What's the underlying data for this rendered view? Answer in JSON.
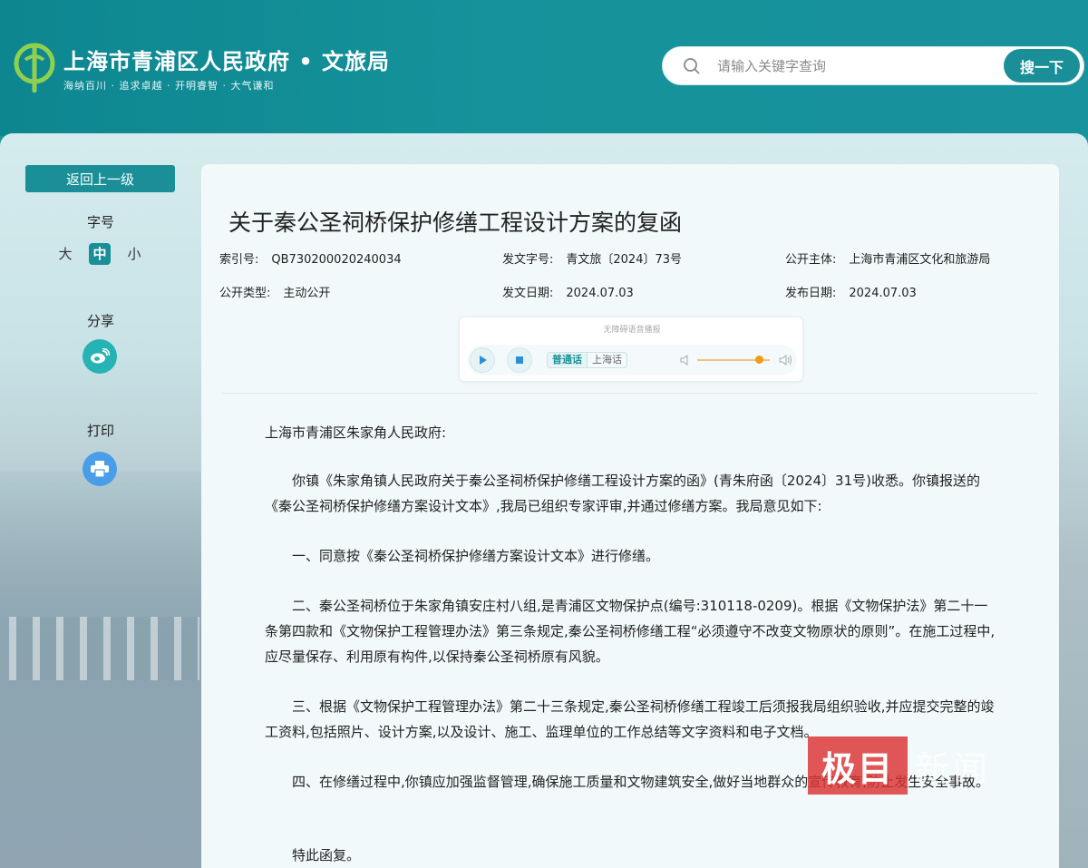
{
  "header": {
    "site_title": "上海市青浦区人民政府 • 文旅局",
    "slogan": "海纳百川 · 追求卓越 · 开明睿智 · 大气谦和",
    "search_placeholder": "请输入关键字查询",
    "search_button": "搜一下"
  },
  "sidebar": {
    "back_button": "返回上一级",
    "font_size_label": "字号",
    "font_sizes": [
      "大",
      "中",
      "小"
    ],
    "share_label": "分享",
    "print_label": "打印"
  },
  "document": {
    "title": "关于秦公圣祠桥保护修缮工程设计方案的复函",
    "meta": {
      "index_key": "索引号:",
      "index_val": "QB730200020240034",
      "docno_key": "发文字号:",
      "docno_val": "青文旅〔2024〕73号",
      "subject_key": "公开主体:",
      "subject_val": "上海市青浦区文化和旅游局",
      "type_key": "公开类型:",
      "type_val": "主动公开",
      "issue_key": "发文日期:",
      "issue_val": "2024.07.03",
      "publish_key": "发布日期:",
      "publish_val": "2024.07.03"
    },
    "player": {
      "title": "无障碍语音播报",
      "lang_mandarin": "普通话",
      "lang_shanghai": "上海话"
    },
    "salutation": "上海市青浦区朱家角人民政府:",
    "paragraphs": [
      "你镇《朱家角镇人民政府关于秦公圣祠桥保护修缮工程设计方案的函》(青朱府函〔2024〕31号)收悉。你镇报送的《秦公圣祠桥保护修缮方案设计文本》,我局已组织专家评审,并通过修缮方案。我局意见如下:",
      "一、同意按《秦公圣祠桥保护修缮方案设计文本》进行修缮。",
      "二、秦公圣祠桥位于朱家角镇安庄村八组,是青浦区文物保护点(编号:310118-0209)。根据《文物保护法》第二十一条第四款和《文物保护工程管理办法》第三条规定,秦公圣祠桥修缮工程“必须遵守不改变文物原状的原则”。在施工过程中,应尽量保存、利用原有构件,以保持秦公圣祠桥原有风貌。",
      "三、根据《文物保护工程管理办法》第二十三条规定,秦公圣祠桥修缮工程竣工后须报我局组织验收,并应提交完整的竣工资料,包括照片、设计方案,以及设计、施工、监理单位的工作总结等文字资料和电子文档。",
      "四、在修缮过程中,你镇应加强监督管理,确保施工质量和文物建筑安全,做好当地群众的宣传教育,防止发生安全事故。",
      "特此函复。"
    ]
  },
  "watermark": {
    "box_text": "极目",
    "text": "新闻"
  }
}
